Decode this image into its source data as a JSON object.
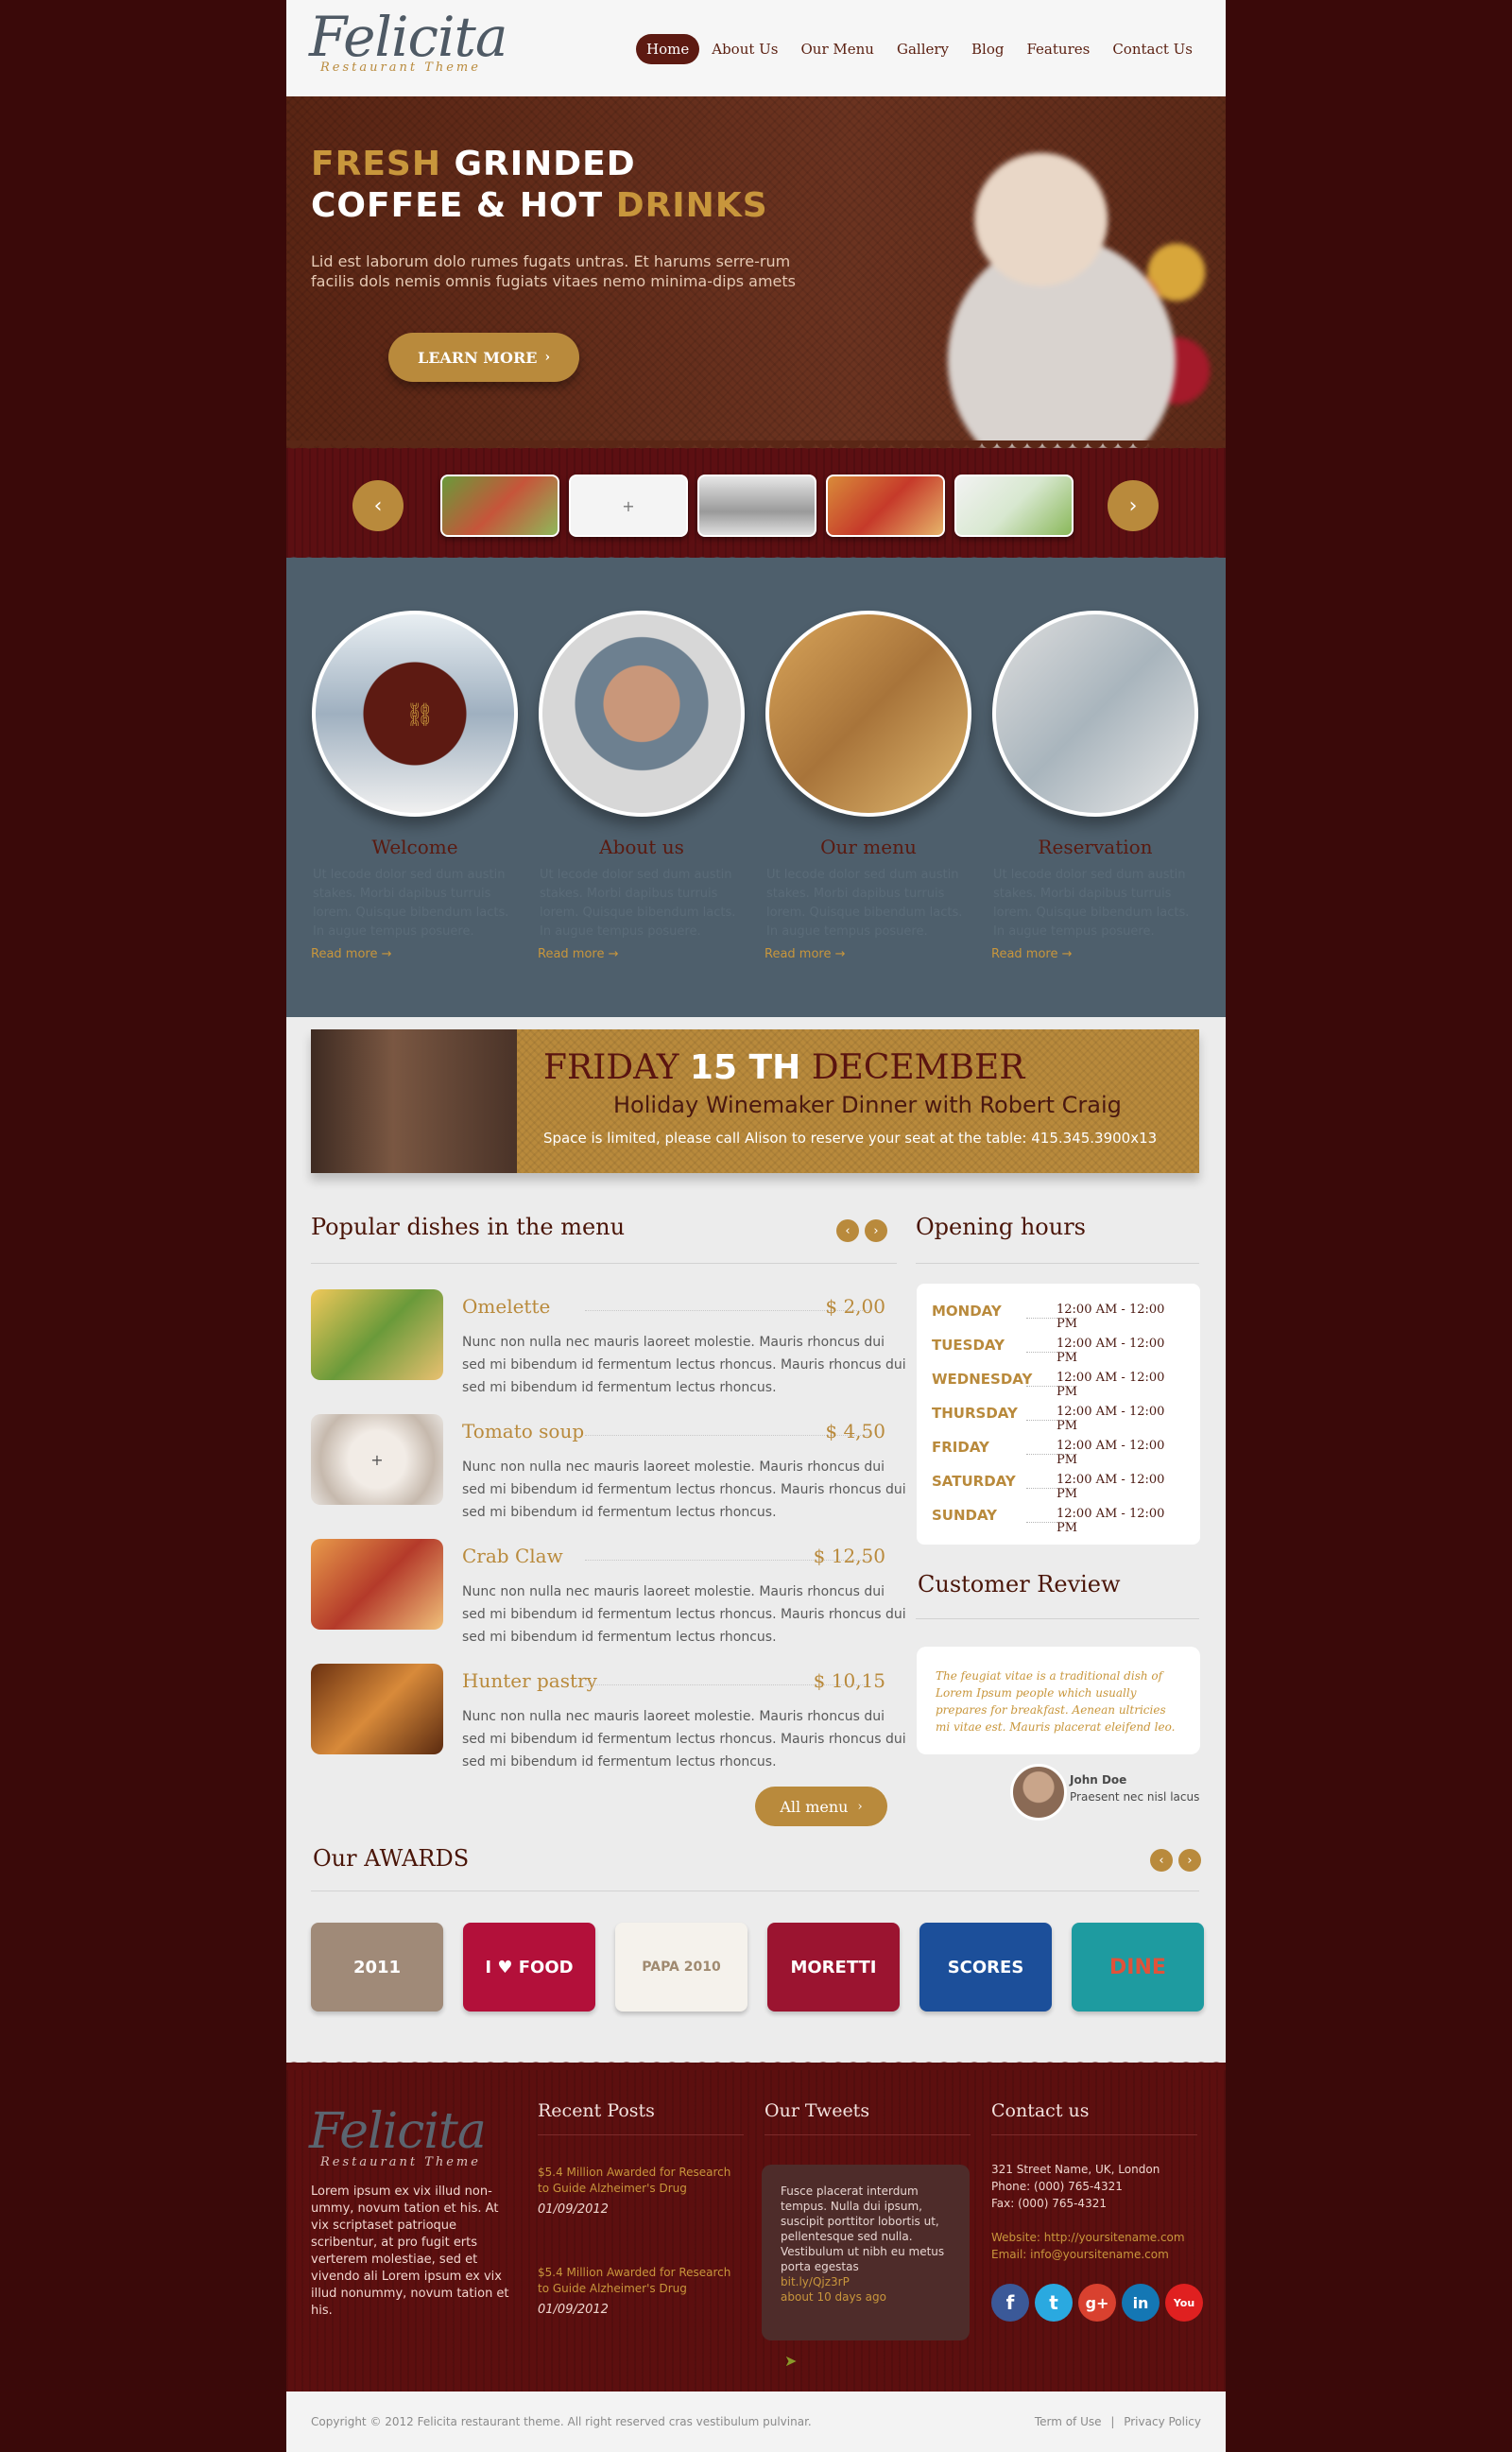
{
  "brand": {
    "name": "Felicita",
    "tagline": "Restaurant Theme"
  },
  "nav": {
    "items": [
      "Home",
      "About Us",
      "Our Menu",
      "Gallery",
      "Blog",
      "Features",
      "Contact Us"
    ],
    "active": "Home"
  },
  "hero": {
    "title_1a": "FRESH ",
    "title_1b": "GRINDED",
    "title_2a": "COFFEE & HOT ",
    "title_2b": "DRINKS",
    "text": "Lid est laborum dolo rumes fugats untras. Et harums serre-rum facilis dols nemis omnis fugiats vitaes nemo minima-dips amets",
    "button": "LEARN MORE",
    "button_icon": "chevron-right-icon"
  },
  "slider": {
    "prev_icon": "chevron-left-icon",
    "next_icon": "chevron-right-icon"
  },
  "features": [
    {
      "title": "Welcome",
      "text": "Ut lecode dolor sed dum austin stakes. Morbi dapibus turruis lorem. Quisque bibendum lacts. In augue tempus posuere.",
      "more": "Read more →"
    },
    {
      "title": "About us",
      "text": "Ut lecode dolor sed dum austin stakes. Morbi dapibus turruis lorem. Quisque bibendum lacts. In augue tempus posuere.",
      "more": "Read more →"
    },
    {
      "title": "Our menu",
      "text": "Ut lecode dolor sed dum austin stakes. Morbi dapibus turruis lorem. Quisque bibendum lacts. In augue tempus posuere.",
      "more": "Read more →"
    },
    {
      "title": "Reservation",
      "text": "Ut lecode dolor sed dum austin stakes. Morbi dapibus turruis lorem. Quisque bibendum lacts. In augue tempus posuere.",
      "more": "Read more →"
    }
  ],
  "event": {
    "day": "FRIDAY ",
    "date": "15 TH",
    "month": " DECEMBER",
    "subtitle": "Holiday Winemaker Dinner with Robert Craig",
    "note": "Space is limited, please call Alison to reserve your seat at the table: 415.345.3900x13"
  },
  "menu": {
    "title": "Popular dishes in the menu",
    "dishes": [
      {
        "name": "Omelette",
        "price": "$ 2,00",
        "desc": "Nunc non nulla nec mauris laoreet molestie. Mauris rhoncus dui sed mi bibendum id fermentum lectus rhoncus. Mauris rhoncus dui sed mi bibendum id fermentum lectus rhoncus."
      },
      {
        "name": "Tomato soup",
        "price": "$ 4,50",
        "desc": "Nunc non nulla nec mauris laoreet molestie. Mauris rhoncus dui sed mi bibendum id fermentum lectus rhoncus. Mauris rhoncus dui sed mi bibendum id fermentum lectus rhoncus."
      },
      {
        "name": "Crab Claw",
        "price": "$ 12,50",
        "desc": "Nunc non nulla nec mauris laoreet molestie. Mauris rhoncus dui sed mi bibendum id fermentum lectus rhoncus. Mauris rhoncus dui sed mi bibendum id fermentum lectus rhoncus."
      },
      {
        "name": "Hunter pastry",
        "price": "$ 10,15",
        "desc": "Nunc non nulla nec mauris laoreet molestie. Mauris rhoncus dui sed mi bibendum id fermentum lectus rhoncus. Mauris rhoncus dui sed mi bibendum id fermentum lectus rhoncus."
      }
    ],
    "all_button": "All menu"
  },
  "hours": {
    "title": "Opening hours",
    "rows": [
      {
        "day": "MONDAY",
        "time": "12:00 AM - 12:00 PM"
      },
      {
        "day": "TUESDAY",
        "time": "12:00 AM - 12:00 PM"
      },
      {
        "day": "WEDNESDAY",
        "time": "12:00 AM - 12:00 PM"
      },
      {
        "day": "THURSDAY",
        "time": "12:00 AM - 12:00 PM"
      },
      {
        "day": "FRIDAY",
        "time": "12:00 AM - 12:00 PM"
      },
      {
        "day": "SATURDAY",
        "time": "12:00 AM - 12:00 PM"
      },
      {
        "day": "SUNDAY",
        "time": "12:00 AM - 12:00 PM"
      }
    ]
  },
  "review": {
    "title": "Customer Review",
    "text": "The feugiat vitae is a traditional dish of Lorem Ipsum people which usually prepares for breakfast. Aenean ultricies mi vitae est. Mauris placerat eleifend leo.",
    "name": "John Doe",
    "role": "Praesent nec nisl lacus"
  },
  "awards": {
    "title": "Our AWARDS",
    "items": [
      {
        "label": "2011",
        "color": "#a08a78"
      },
      {
        "label": "I ♥ FOOD",
        "color": "#b3103a"
      },
      {
        "label": "PAPA 2010",
        "color": "#f5f2ec"
      },
      {
        "label": "MORETTI",
        "color": "#9b1430"
      },
      {
        "label": "SCORES",
        "color": "#1c4f9a"
      },
      {
        "label": "DINE",
        "color": "#1e9ba0"
      }
    ]
  },
  "footer": {
    "about": "Lorem ipsum ex vix illud non-ummy, novum tation et his. At vix scriptaset patrioque scribentur, at pro fugit erts verterem molestiae, sed et vivendo ali Lorem ipsum ex vix illud nonummy, novum tation et his.",
    "recent_title": "Recent Posts",
    "posts": [
      {
        "title": "$5.4 Million Awarded for Research to Guide Alzheimer's Drug",
        "date": "01/09/2012"
      },
      {
        "title": "$5.4 Million Awarded for Research to Guide Alzheimer's Drug",
        "date": "01/09/2012"
      }
    ],
    "tweets_title": "Our Tweets",
    "tweet": "Fusce placerat interdum tempus. Nulla dui ipsum, suscipit porttitor lobortis ut, pellentesque sed nulla. Vestibulum ut nibh eu metus porta egestas",
    "tweet_link": "bit.ly/Qjz3rP",
    "tweet_time": "about 10 days ago",
    "contact_title": "Contact us",
    "address": "321 Street Name, UK, London",
    "phone": "Phone: (000) 765-4321",
    "fax": "Fax: (000) 765-4321",
    "website": "Website:  http://yoursitename.com",
    "email": "Email:  info@yoursitename.com",
    "social": [
      {
        "icon": "facebook-icon",
        "glyph": "f",
        "color": "#3b5998"
      },
      {
        "icon": "twitter-icon",
        "glyph": "t",
        "color": "#2aa9e0"
      },
      {
        "icon": "google-plus-icon",
        "glyph": "g+",
        "color": "#d9412f"
      },
      {
        "icon": "linkedin-icon",
        "glyph": "in",
        "color": "#1477b4"
      },
      {
        "icon": "youtube-icon",
        "glyph": "You",
        "color": "#e02020"
      }
    ]
  },
  "copyright": {
    "text": "Copyright © 2012 Felicita restaurant theme. All right reserved cras vestibulum pulvinar.",
    "terms": "Term of Use",
    "privacy": "Privacy Policy",
    "separator": "|"
  }
}
